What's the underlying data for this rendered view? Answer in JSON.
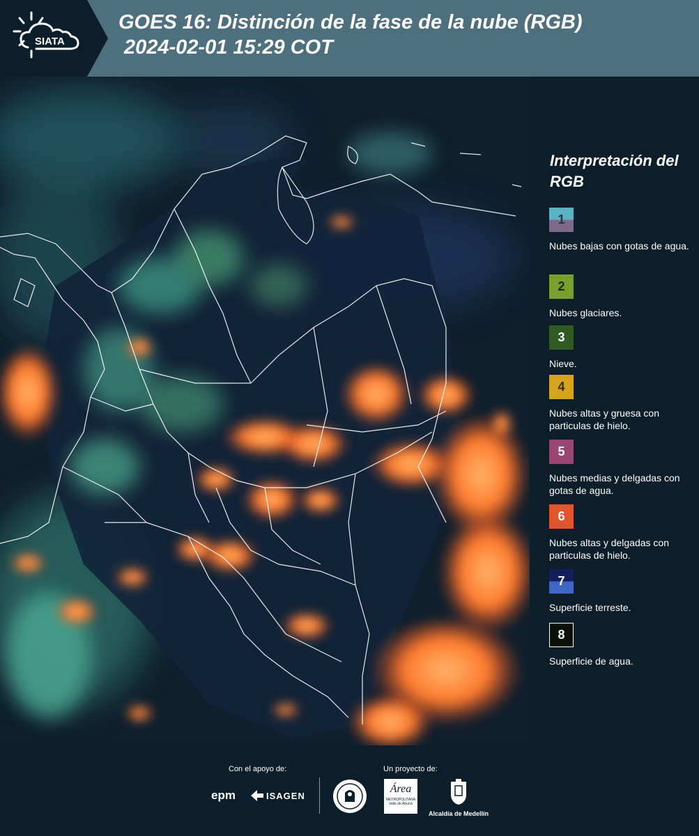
{
  "header": {
    "logo_text": "SIATA",
    "title_line1": "GOES 16: Distinción de la fase de la nube (RGB)",
    "title_line2": "2024-02-01 15:29 COT"
  },
  "legend": {
    "title": "Interpretación del RGB",
    "items": [
      {
        "number": "1",
        "label": "Nubes bajas con gotas de agua.",
        "color": "#5ab3c4"
      },
      {
        "number": "2",
        "label": "Nubes glaciares.",
        "color": "#78a02e"
      },
      {
        "number": "3",
        "label": "Nieve.",
        "color": "#2f5a22"
      },
      {
        "number": "4",
        "label": "Nubes altas y gruesa con particulas de hielo.",
        "color": "#d6a41b"
      },
      {
        "number": "5",
        "label": "Nubes medias y delgadas con gotas de agua.",
        "color": "#9a4673"
      },
      {
        "number": "6",
        "label": "Nubes altas y delgadas con particulas de hielo.",
        "color": "#e0562c"
      },
      {
        "number": "7",
        "label": "Superficie terreste.",
        "color": "#1b2c6e"
      },
      {
        "number": "8",
        "label": "Superficie de agua.",
        "color": "#0a1208"
      }
    ]
  },
  "footer": {
    "support_caption": "Con el apoyo de:",
    "project_caption": "Un proyecto de:",
    "logo_epm": "epm",
    "logo_isagen": "ISAGEN",
    "logo_area": "Área",
    "logo_area_sub": "METROPOLITANA",
    "logo_area_sub2": "Valle de Aburrá",
    "logo_alcaldia": "Alcaldía de Medellín"
  }
}
